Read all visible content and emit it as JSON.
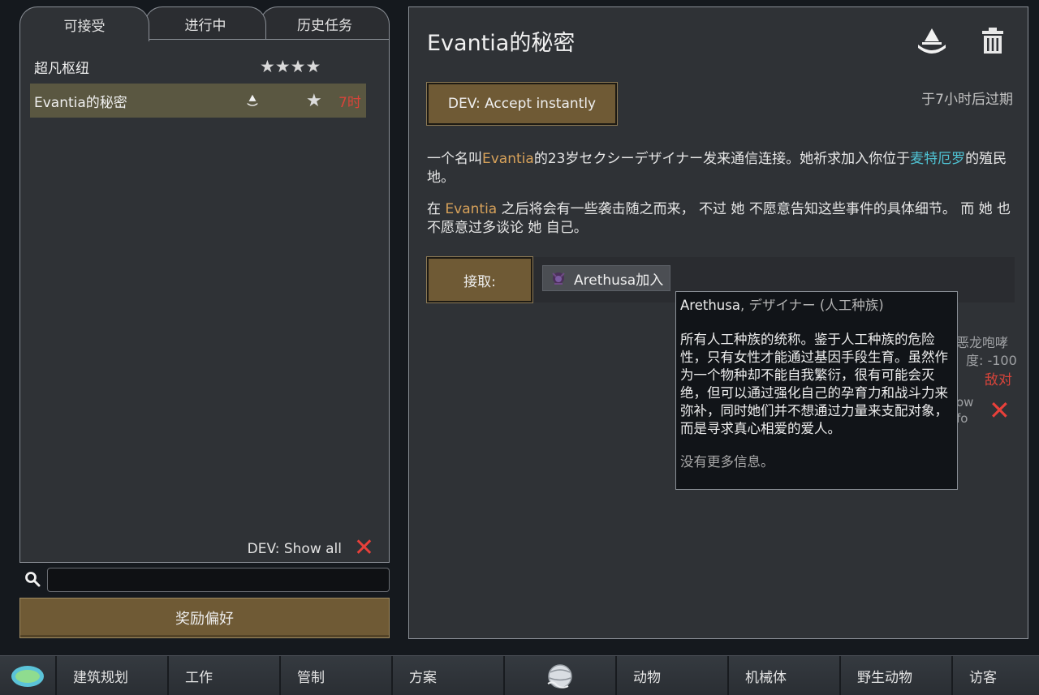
{
  "tabs": [
    {
      "label": "可接受"
    },
    {
      "label": "进行中"
    },
    {
      "label": "历史任务"
    }
  ],
  "quests": [
    {
      "title": "超凡枢纽",
      "stars": "★★★★"
    },
    {
      "title": "Evantia的秘密",
      "star": "★",
      "time": "7时"
    }
  ],
  "left": {
    "dev_show_all": "DEV: Show all",
    "x_mark": "✕",
    "search_placeholder": "",
    "reward_pref_button": "奖励偏好"
  },
  "detail": {
    "title": "Evantia的秘密",
    "dev_accept_button": "DEV: Accept instantly",
    "expires": "于7小时后过期",
    "desc1_a": "一个名叫",
    "desc1_name": "Evantia",
    "desc1_b": "的23岁セクシーデザイナー发来通信连接。她祈求加入你位于",
    "desc1_place": "麦特厄罗",
    "desc1_c": "的殖民地。",
    "desc2_a": "在 ",
    "desc2_name": "Evantia",
    "desc2_b": " 之后将会有一些袭击随之而来， 不过 她 不愿意告知这些事件的具体细节。 而 她 也不愿意过多谈论 她 自己。",
    "accept_button": "接取:",
    "reward_chip": "Arethusa加入",
    "faded_1": "恶龙咆哮",
    "faded_2": "度: -100",
    "hostile": "敌对",
    "faded_3": "ow",
    "faded_4": "fo",
    "x_mark": "✕"
  },
  "tooltip": {
    "name": "Arethusa",
    "sub": ", デザイナー (人工种族)",
    "body": "所有人工种族的统称。鉴于人工种族的危险性，只有女性才能通过基因手段生育。虽然作为一个物种却不能自我繁衍，很有可能会灭绝，但可以通过强化自己的孕育力和战斗力来弥补，同时她们并不想通过力量来支配对象，而是寻求真心相爱的爱人。",
    "footer": "没有更多信息。"
  },
  "bottom_bar": [
    {
      "label": "",
      "kind": "logo"
    },
    {
      "label": "建筑规划"
    },
    {
      "label": "工作"
    },
    {
      "label": "管制"
    },
    {
      "label": "方案"
    },
    {
      "label": "",
      "kind": "globe"
    },
    {
      "label": "动物"
    },
    {
      "label": "机械体"
    },
    {
      "label": "野生动物"
    },
    {
      "label": "访客"
    }
  ]
}
